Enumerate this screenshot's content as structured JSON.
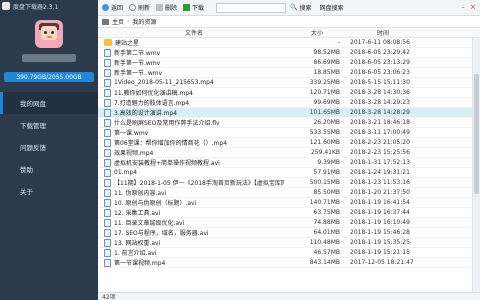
{
  "app": {
    "title": "度盘下载器2.3.1"
  },
  "user": {
    "storage": "390.79GB/2055.00GB"
  },
  "sidebar": {
    "items": [
      {
        "label": "我的网盘",
        "active": true
      },
      {
        "label": "下载管理"
      },
      {
        "label": "问题反馈"
      },
      {
        "label": "赞助"
      },
      {
        "label": "关于"
      }
    ]
  },
  "toolbar": {
    "back": "返回",
    "refresh": "刷新",
    "delete": "删除",
    "download": "下载",
    "search_button": "搜索",
    "net_search": "网盘搜索",
    "search_placeholder": ""
  },
  "breadcrumb": {
    "home": "主页",
    "current": "我的资源"
  },
  "table": {
    "headers": {
      "name": "文件名",
      "size": "大小",
      "time": "时间"
    },
    "rows": [
      {
        "type": "folder",
        "name": "建站之星",
        "size": "-",
        "time": "2017-6-11 08:08:56"
      },
      {
        "type": "file",
        "name": "新手第二节.wmv",
        "size": "98.52MB",
        "time": "2018-6-05 23:29:42"
      },
      {
        "type": "file",
        "name": "新手第一节.wmv",
        "size": "86.69MB",
        "time": "2018-6-05 23:13:29"
      },
      {
        "type": "file",
        "name": "新手第一节..wmv",
        "size": "18.85MB",
        "time": "2018-6-05 23:06:23"
      },
      {
        "type": "file",
        "name": "1Video_2018-05-11_215653.mp4",
        "size": "339.25MB",
        "time": "2018-5-15 15:11:30"
      },
      {
        "type": "file",
        "name": "11.教你如何优化演讲稿.mp4",
        "size": "120.71MB",
        "time": "2018-3-28 14:30:36"
      },
      {
        "type": "file",
        "name": "7.打造魅力的肢体语言.mp4",
        "size": "99.69MB",
        "time": "2018-3-28 14:29:23"
      },
      {
        "type": "file",
        "name": "3.高效的设计演讲.mp4",
        "size": "101.65MB",
        "time": "2018-3-28 14:28:29",
        "selected": true
      },
      {
        "type": "file",
        "name": "什么是刷屏SEO及常用作弊手法介绍.flv",
        "size": "26.20MB",
        "time": "2018-3-21 18:46:18"
      },
      {
        "type": "file",
        "name": "第一课.wmv",
        "size": "533.55MB",
        "time": "2018-3-11 17:00:49"
      },
      {
        "type": "file",
        "name": "第06堂课：帮你增加你的情商花（）.mp4",
        "size": "121.60MB",
        "time": "2018-2-23 21:05:20"
      },
      {
        "type": "file",
        "name": "效果视频.mp4",
        "size": "259.41KB",
        "time": "2018-2-23 15:25:56"
      },
      {
        "type": "file",
        "name": "虚拟机安装教程+简单操作视频教程.avi",
        "size": "9.39MB",
        "time": "2018-1-31 17:52:13"
      },
      {
        "type": "file",
        "name": "01.mp4",
        "size": "57.91MB",
        "time": "2018-1-24 19:31:21"
      },
      {
        "type": "file",
        "name": "【11期】2018-1-05 伊一《2018手淘首页新玩法》【虚拟宝库网ww",
        "size": "500.15MB",
        "time": "2018-1-23 11:53:16"
      },
      {
        "type": "file",
        "name": "11. 伪原创内容.avi",
        "size": "85.50MB",
        "time": "2018-1-20 21:37:50"
      },
      {
        "type": "file",
        "name": "10. 原创与伪原创（标题）.avi",
        "size": "140.71MB",
        "time": "2018-1-19 16:41:54"
      },
      {
        "type": "file",
        "name": "12. 采集工具.avi",
        "size": "63.75MB",
        "time": "2018-1-19 16:37:44"
      },
      {
        "type": "file",
        "name": "11. 目录文章层级优化.avi",
        "size": "74.88MB",
        "time": "2018-1-19 16:10:49"
      },
      {
        "type": "file",
        "name": "17. SEO与程序，域名，服务器.avi",
        "size": "64.01MB",
        "time": "2018-1-19 15:46:28"
      },
      {
        "type": "file",
        "name": "13. 网站权重.avi",
        "size": "110.48MB",
        "time": "2018-1-19 15:35:25"
      },
      {
        "type": "file",
        "name": "1. 前言介绍.avi",
        "size": "46.57MB",
        "time": "2018-1-19 15:21:15"
      },
      {
        "type": "file",
        "name": "第一节课视频.mp4",
        "size": "843.14MB",
        "time": "2017-12-05 18:21:47"
      }
    ]
  },
  "status": {
    "count": "42项"
  }
}
